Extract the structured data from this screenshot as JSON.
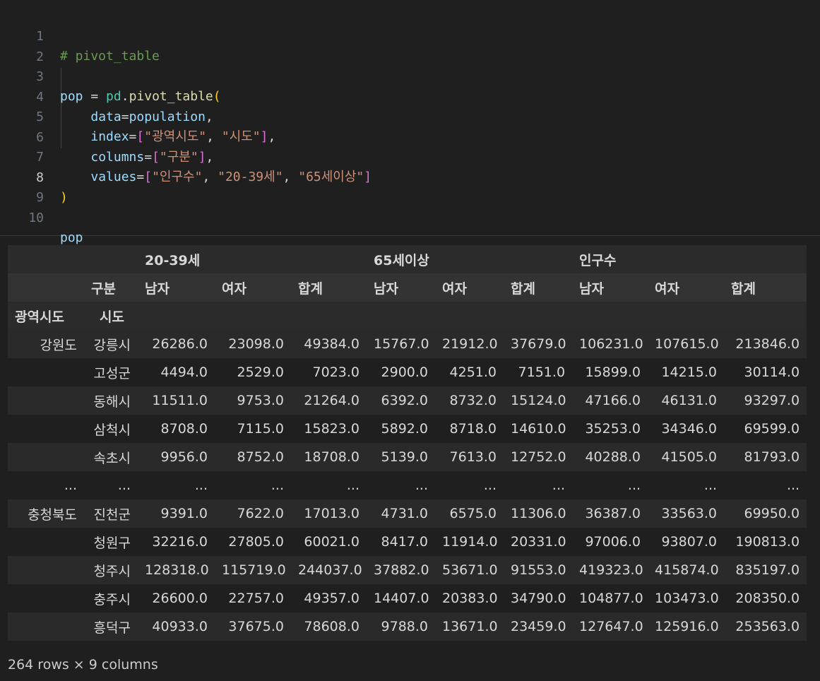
{
  "editor": {
    "line_numbers": [
      "1",
      "2",
      "3",
      "4",
      "5",
      "6",
      "7",
      "8",
      "9",
      "10"
    ],
    "comment": "# pivot_table",
    "var_pop": "pop",
    "eq": " = ",
    "pd": "pd",
    "dot": ".",
    "fn": "pivot_table",
    "paren_open": "(",
    "paren_close": ")",
    "data_kw": "data",
    "data_val": "population",
    "index_kw": "index",
    "index_s1": "\"광역시도\"",
    "index_s2": "\"시도\"",
    "columns_kw": "columns",
    "columns_s1": "\"구분\"",
    "values_kw": "values",
    "values_s1": "\"인구수\"",
    "values_s2": "\"20-39세\"",
    "values_s3": "\"65세이상\"",
    "last_line": "pop",
    "active_line": "8"
  },
  "dataframe": {
    "top_headers": [
      "20-39세",
      "65세이상",
      "인구수"
    ],
    "columns_name": "구분",
    "sub_headers": [
      "남자",
      "여자",
      "합계",
      "남자",
      "여자",
      "합계",
      "남자",
      "여자",
      "합계"
    ],
    "index_names": [
      "광역시도",
      "시도"
    ],
    "rows": [
      {
        "l1": "강원도",
        "l2": "강릉시",
        "v": [
          "26286.0",
          "23098.0",
          "49384.0",
          "15767.0",
          "21912.0",
          "37679.0",
          "106231.0",
          "107615.0",
          "213846.0"
        ]
      },
      {
        "l1": "",
        "l2": "고성군",
        "v": [
          "4494.0",
          "2529.0",
          "7023.0",
          "2900.0",
          "4251.0",
          "7151.0",
          "15899.0",
          "14215.0",
          "30114.0"
        ]
      },
      {
        "l1": "",
        "l2": "동해시",
        "v": [
          "11511.0",
          "9753.0",
          "21264.0",
          "6392.0",
          "8732.0",
          "15124.0",
          "47166.0",
          "46131.0",
          "93297.0"
        ]
      },
      {
        "l1": "",
        "l2": "삼척시",
        "v": [
          "8708.0",
          "7115.0",
          "15823.0",
          "5892.0",
          "8718.0",
          "14610.0",
          "35253.0",
          "34346.0",
          "69599.0"
        ]
      },
      {
        "l1": "",
        "l2": "속초시",
        "v": [
          "9956.0",
          "8752.0",
          "18708.0",
          "5139.0",
          "7613.0",
          "12752.0",
          "40288.0",
          "41505.0",
          "81793.0"
        ]
      },
      {
        "l1": "...",
        "l2": "...",
        "v": [
          "...",
          "...",
          "...",
          "...",
          "...",
          "...",
          "...",
          "...",
          "..."
        ]
      },
      {
        "l1": "충청북도",
        "l2": "진천군",
        "v": [
          "9391.0",
          "7622.0",
          "17013.0",
          "4731.0",
          "6575.0",
          "11306.0",
          "36387.0",
          "33563.0",
          "69950.0"
        ]
      },
      {
        "l1": "",
        "l2": "청원구",
        "v": [
          "32216.0",
          "27805.0",
          "60021.0",
          "8417.0",
          "11914.0",
          "20331.0",
          "97006.0",
          "93807.0",
          "190813.0"
        ]
      },
      {
        "l1": "",
        "l2": "청주시",
        "v": [
          "128318.0",
          "115719.0",
          "244037.0",
          "37882.0",
          "53671.0",
          "91553.0",
          "419323.0",
          "415874.0",
          "835197.0"
        ]
      },
      {
        "l1": "",
        "l2": "충주시",
        "v": [
          "26600.0",
          "22757.0",
          "49357.0",
          "14407.0",
          "20383.0",
          "34790.0",
          "104877.0",
          "103473.0",
          "208350.0"
        ]
      },
      {
        "l1": "",
        "l2": "흥덕구",
        "v": [
          "40933.0",
          "37675.0",
          "78608.0",
          "9788.0",
          "13671.0",
          "23459.0",
          "127647.0",
          "125916.0",
          "253563.0"
        ]
      }
    ],
    "footer": "264 rows × 9 columns"
  }
}
